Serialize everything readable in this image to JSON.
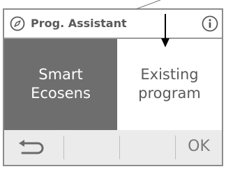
{
  "header": {
    "title": "Prog. Assistant",
    "left_icon": "compass-icon",
    "right_icon": "info-icon"
  },
  "options": {
    "left": {
      "line1": "Smart",
      "line2": "Ecosens"
    },
    "right": {
      "line1": "Existing",
      "line2": "program"
    }
  },
  "footer": {
    "back_icon": "back-arrow-icon",
    "ok_label": "OK"
  },
  "colors": {
    "selected_panel": "#6e6e6e",
    "footer_bg": "#ebebeb",
    "text_gray": "#5a5a5a",
    "border_gray": "#8c8c8c"
  }
}
